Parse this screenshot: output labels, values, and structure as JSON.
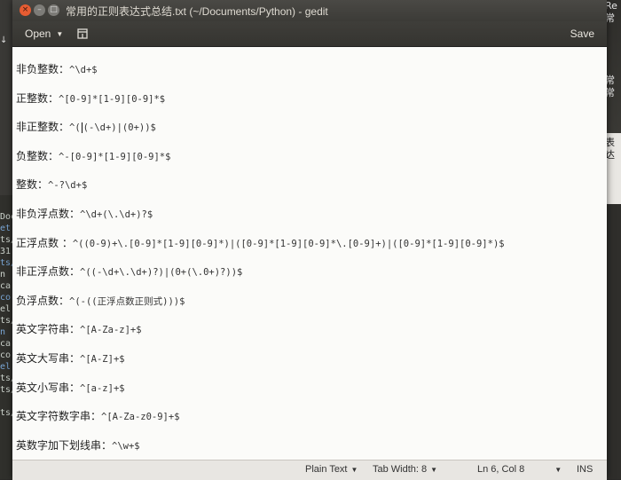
{
  "window": {
    "title": "常用的正则表达式总结.txt (~/Documents/Python) - gedit",
    "close_symbol": "×",
    "min_symbol": "–",
    "max_symbol": "□"
  },
  "toolbar": {
    "open_label": "Open",
    "open_icon": "chevron-down-icon",
    "pin_icon": "pin-document-icon",
    "save_label": "Save"
  },
  "editor": {
    "lines": [
      {
        "label": "非负整数：",
        "code": "^\\d+$"
      },
      {
        "label": "正整数：",
        "code": "^[0-9]*[1-9][0-9]*$"
      },
      {
        "label": "非正整数：",
        "code_pre": "^(",
        "code": "(-\\d+)|(0+))$"
      },
      {
        "label": "负整数：",
        "code": "^-[0-9]*[1-9][0-9]*$"
      },
      {
        "label": "整数：",
        "code": "^-?\\d+$"
      },
      {
        "label": "非负浮点数：",
        "code": "^\\d+(\\.\\d+)?$"
      },
      {
        "label": "正浮点数 ：",
        "code": "^((0-9)+\\.[0-9]*[1-9][0-9]*)|([0-9]*[1-9][0-9]*\\.[0-9]+)|([0-9]*[1-9][0-9]*)$"
      },
      {
        "label": "非正浮点数：",
        "code": "^((-\\d+\\.\\d+)?)|(0+(\\.0+)?))$"
      },
      {
        "label": "负浮点数：",
        "code": "^(-((正浮点数正则式)))$"
      },
      {
        "label": "英文字符串：",
        "code": "^[A-Za-z]+$"
      },
      {
        "label": "英文大写串：",
        "code": "^[A-Z]+$"
      },
      {
        "label": "英文小写串：",
        "code": "^[a-z]+$"
      },
      {
        "label": "英文字符数字串：",
        "code": "^[A-Za-z0-9]+$"
      },
      {
        "label": "英数字加下划线串：",
        "code": "^\\w+$"
      }
    ]
  },
  "statusbar": {
    "language": "Plain Text",
    "tab_width": "Tab Width: 8",
    "position": "Ln 6, Col 8",
    "mode": "INS"
  },
  "background": {
    "left_top": "↓",
    "left_lines": [
      "Doc",
      "et",
      "ts/",
      "31",
      "ts/",
      "n",
      "ca",
      "co",
      "el",
      "ts/",
      "n",
      "ca",
      "co",
      "el",
      "ts/",
      "ts/",
      "",
      "ts/"
    ],
    "right_lines": [
      "Re",
      "常",
      "",
      "",
      "",
      "",
      "常",
      "常",
      "",
      "",
      "",
      "表达",
      "t"
    ]
  },
  "colors": {
    "accent_close": "#e65c32",
    "titlebar": "#3c3b37",
    "editor_bg": "#fbfbf9"
  }
}
